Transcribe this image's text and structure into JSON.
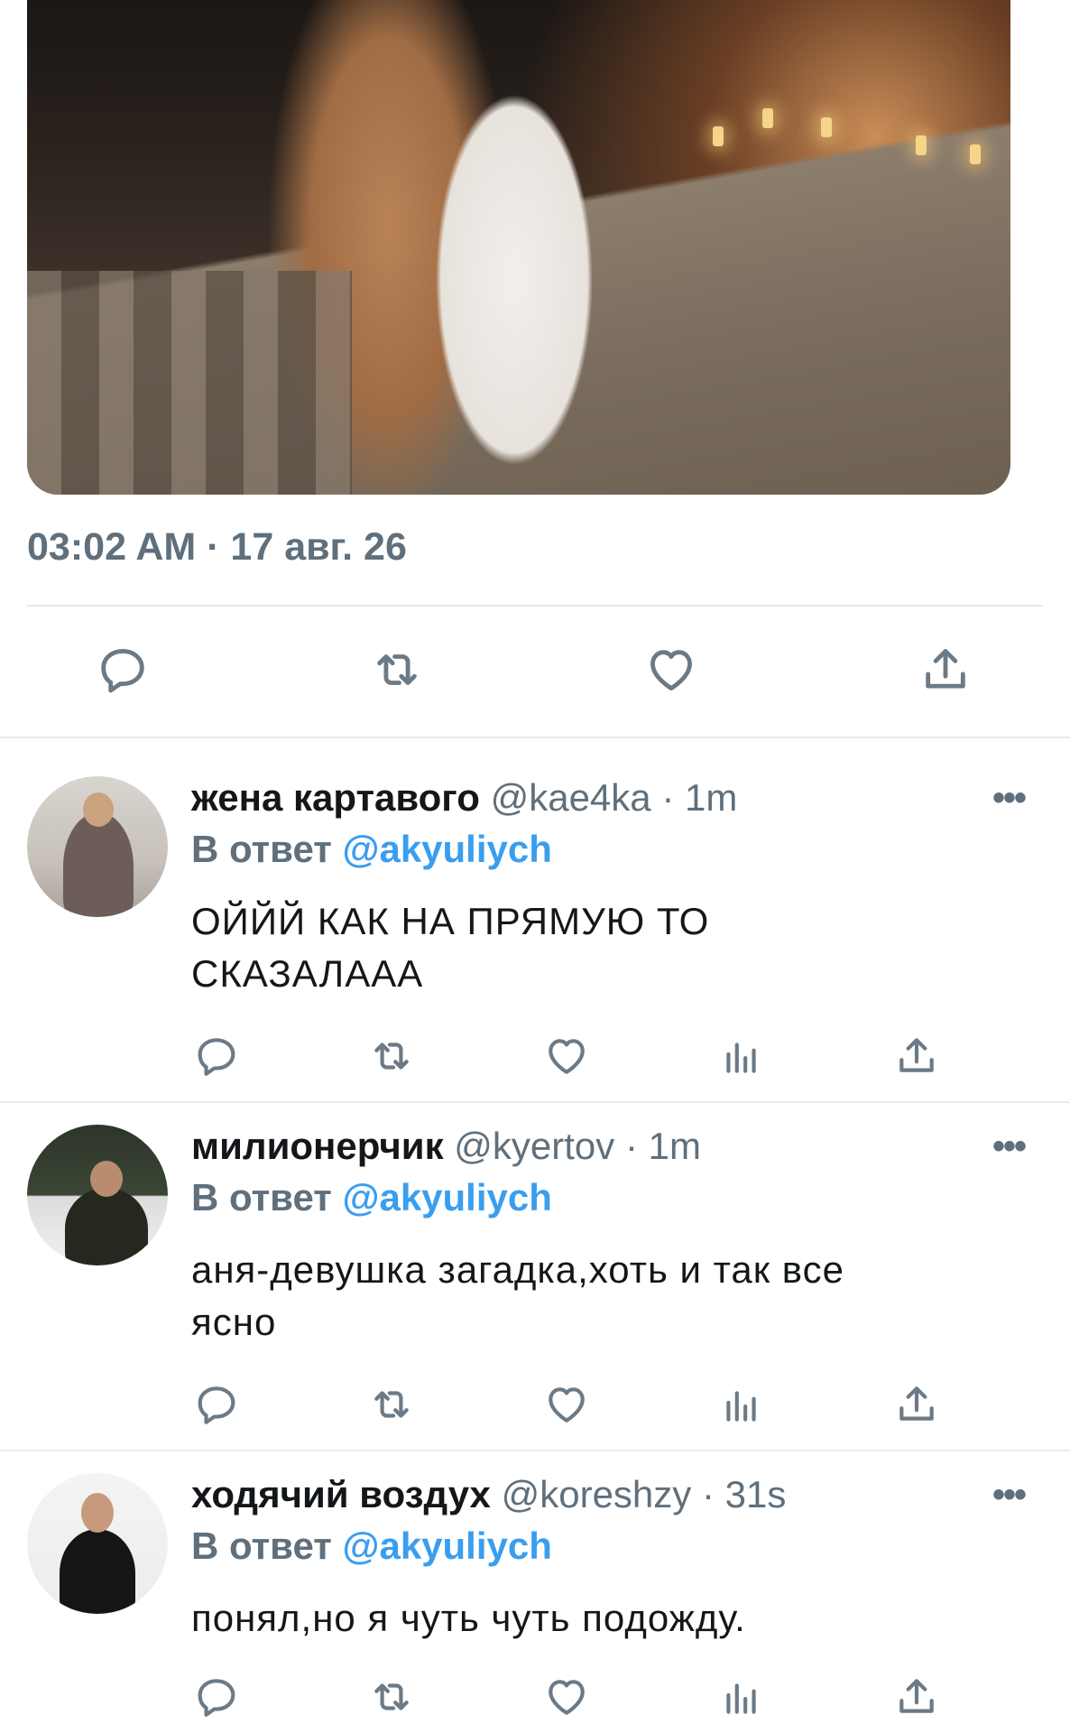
{
  "tweet": {
    "timestamp": "03:02 AM · 17 авг. 26"
  },
  "icons": {
    "reply": "reply-icon",
    "retweet": "retweet-icon",
    "like": "like-icon",
    "share": "share-icon",
    "analytics": "analytics-icon",
    "more": "more-icon"
  },
  "colors": {
    "mention": "#3a9eef",
    "muted": "#5f6f7c",
    "icon": "#6b7a86"
  },
  "replies": [
    {
      "name": "жена картавого",
      "handle": "@kae4ka",
      "time": "1m",
      "reply_to_label": "В ответ",
      "reply_to_handle": "@akyuliych",
      "text_line1": "ОЙЙЙ КАК НА ПРЯМУЮ ТО",
      "text_line2": "СКАЗАЛААА"
    },
    {
      "name": "милионерчик",
      "handle": "@kyertov",
      "time": "1m",
      "reply_to_label": "В ответ",
      "reply_to_handle": "@akyuliych",
      "text_line1": "аня-девушка загадка,хоть и так все",
      "text_line2": "ясно"
    },
    {
      "name": "ходячий воздух",
      "handle": "@koreshzy",
      "time": "31s",
      "reply_to_label": "В ответ",
      "reply_to_handle": "@akyuliych",
      "text_line1": "понял,но я чуть чуть подожду.",
      "text_line2": ""
    }
  ]
}
